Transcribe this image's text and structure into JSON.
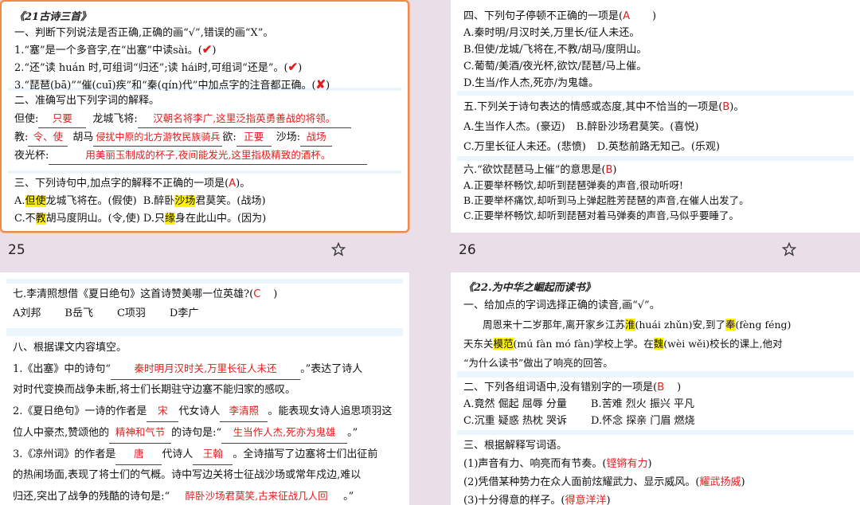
{
  "slide25": {
    "page_number": "25",
    "title": "《21古诗三首》",
    "q1": {
      "heading": "一、判断下列说法是否正确,正确的画“√”,错误的画“X”。",
      "items": [
        {
          "text": "1.“塞”是一个多音字,在“出塞”中读sài。(",
          "mark": "✔",
          "close": ")"
        },
        {
          "text": "2.“还”读 huán 时,可组词“归还”;读 hái时,可组词“还是”。(",
          "mark": "✔",
          "close": ")"
        },
        {
          "text": "3.“琵琶(bā)”“催(cuī)疾”和“秦(qín)代”中加点字的注音都正确。(",
          "mark": "✘",
          "close": ")"
        }
      ]
    },
    "q2": {
      "heading": "二、准确写出下列字词的解释。",
      "l1_a": "但使:",
      "l1_a_ans": "只要",
      "l1_b": "龙城飞将:",
      "l1_b_ans": "汉朝名将李广,这里泛指英勇善战的将领。",
      "l2_a": "教:",
      "l2_a_ans": "令、使",
      "l2_b": "胡马",
      "l2_b_ans": "侵扰中原的北方游牧民族骑兵",
      "l2_c": "欲:",
      "l2_c_ans": "正要",
      "l2_d": "沙场:",
      "l2_d_ans": "战场",
      "l3_a": "夜光杯:",
      "l3_a_ans": "用美丽玉制成的杯子,夜间能发光,这里指极精致的酒杯。"
    },
    "q3": {
      "heading": "三、下列诗句中,加点字的解释不正确的一项是(",
      "heading_ans": "A",
      "heading_end": ")。",
      "a_pre": "A.",
      "a_hl": "但使",
      "a_post": "龙城飞将在。(假使)",
      "b_pre": "B.醉卧",
      "b_hl": "沙场",
      "b_post": "君莫笑。(战场)",
      "c_pre": "C.不",
      "c_hl": "教",
      "c_post": "胡马度阴山。(令,使)",
      "d_pre": "D.只",
      "d_hl": "缘",
      "d_post": "身在此山中。(因为)"
    }
  },
  "slide26": {
    "page_number": "26",
    "q4": {
      "heading": "四、下列句子停顿不正确的一项是(",
      "heading_ans": "A",
      "heading_end": ")",
      "options": [
        "A.秦时明/月汉时关,万里长/征人未还。",
        "B.但使/龙城/飞将在,不教/胡马/度阴山。",
        "C.葡萄/美酒/夜光杯,欲饮/琵琶/马上催。",
        "D.生当/作人杰,死亦/为鬼雄。"
      ]
    },
    "q5": {
      "heading": "五.下列关于诗句表达的情感或态度,其中不恰当的一项是(",
      "heading_ans": "B",
      "heading_end": ")。",
      "a": "A.生当作人杰。(豪迈)",
      "b": "B.醉卧沙场君莫笑。(喜悦)",
      "c": "C.万里长征人未还。(悲愤)",
      "d": "D.英愁前路无知己。(乐观)"
    },
    "q6": {
      "heading": "六.“欲饮琵琶马上催”的意思是(",
      "heading_ans": "B",
      "heading_end": ")",
      "options": [
        "A.正要举杯畅饮,却听到琵琶弹奏的声音,很动听呀!",
        "B.正要举杯痛饮,却听到马上弹起胜芳琵琶的声音,在催人出发了。",
        "C.正要举杯畅饮,却听到琵琶对着马弹奏的声音,马似乎要睡了。"
      ]
    }
  },
  "slide27": {
    "q7": {
      "heading": "七.李清照想借《夏日绝句》这首诗赞美哪一位英雄?(",
      "heading_ans": "C",
      "heading_end": ")",
      "options": [
        "A刘邦",
        "B岳飞",
        "C项羽",
        "D李广"
      ]
    },
    "q8": {
      "heading": "八、根据课文内容填空。",
      "l1_a": "1.《出塞》中的诗句“",
      "l1_ans": "秦时明月汉时关,万里长征人未还",
      "l1_b": "。”表达了诗人",
      "l2": "对时代变换而战争未断,将士们长期驻守边塞不能归家的感叹。",
      "l3_a": "2.《夏日绝句》一诗的作者是",
      "l3_ans1": "宋",
      "l3_b": "代女诗人",
      "l3_ans2": "李清照",
      "l3_c": "。能表现女诗人追思项羽这",
      "l4_a": "位人中豪杰,赞颂他的",
      "l4_ans1": "精神和气节",
      "l4_b": "的诗句是:“",
      "l4_ans2": "生当作人杰,死亦为鬼雄",
      "l4_c": "。”",
      "l5_a": "3.《凉州词》的作者是",
      "l5_ans1": "唐",
      "l5_b": "代诗人",
      "l5_ans2": "王翰",
      "l5_c": "。全诗描写了边塞将士们出征前",
      "l6": "的热闹场面,表现了将士们的气概。诗中写边关将士征战沙场或常年戍边,难以",
      "l7_a": "归还,突出了战争的残酷的诗句是:“",
      "l7_ans": "醉卧沙场君莫笑,古来征战几人回",
      "l7_b": "。”"
    }
  },
  "slide28": {
    "title": "《22.为中华之崛起而读书》",
    "q1": {
      "heading": "一、给加点的字词选择正确的读音,画“√”。",
      "l1_a": "周恩来十二岁那年,离开家乡江苏",
      "l1_hl1": "淮",
      "l1_b": "(huái  zhǔn)安,到了",
      "l1_hl2": "奉",
      "l1_c": "(fèng  féng)",
      "l2_a": "天东关",
      "l2_hl1": "模范",
      "l2_b": "(mú fàn   mó fàn)学校上学。在",
      "l2_hl2": "魏",
      "l2_c": "(wèi  wěi)校长的课上,他对",
      "l3": "“为什么读书”做出了响亮的回答。"
    },
    "q2": {
      "heading": "二、下列各组词语中,没有错别字的一项是(",
      "heading_ans": "B",
      "heading_end": ")",
      "a": "A.竟然  倔起  屈辱  分量",
      "b": "B.苦难  烈火  振兴  平凡",
      "c": "C.沉重  疑惑  热枕  哭诉",
      "d": "D.怀念  探亲  门眉  燃烧"
    },
    "q3": {
      "heading": "三、根据解释写词语。",
      "l1": "(1)声音有力、响亮而有节奏。(",
      "l1_ans": "铿锵有力",
      "l1_end": ")",
      "l2": "(2)凭借某种势力在众人面前炫耀武力、显示威风。(",
      "l2_ans": "耀武扬威",
      "l2_end": ")",
      "l3": "(3)十分得意的样子。(",
      "l3_ans": "得意洋洋",
      "l3_end": ")"
    }
  }
}
